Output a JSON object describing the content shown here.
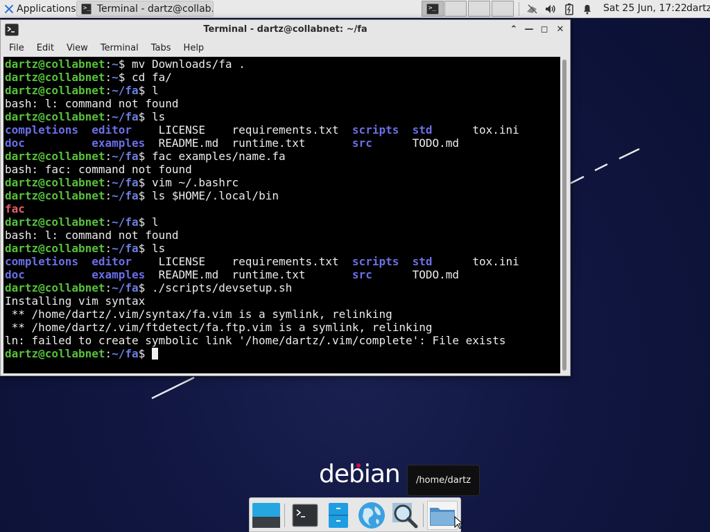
{
  "panel": {
    "apps_label": "Applications",
    "task_label": "Terminal - dartz@collab...",
    "clock": "Sat 25 Jun, 17:22",
    "user": "dartz"
  },
  "window": {
    "title": "Terminal - dartz@collabnet: ~/fa",
    "menu": [
      "File",
      "Edit",
      "View",
      "Terminal",
      "Tabs",
      "Help"
    ]
  },
  "terminal": {
    "user": "dartz@collabnet",
    "lines": [
      {
        "kind": "prompt",
        "path": "~",
        "cmd": "mv Downloads/fa ."
      },
      {
        "kind": "prompt",
        "path": "~",
        "cmd": "cd fa/"
      },
      {
        "kind": "prompt",
        "path": "~/fa",
        "cmd": "l"
      },
      {
        "kind": "out",
        "text": "bash: l: command not found"
      },
      {
        "kind": "prompt",
        "path": "~/fa",
        "cmd": "ls"
      },
      {
        "kind": "ls1"
      },
      {
        "kind": "ls2"
      },
      {
        "kind": "prompt",
        "path": "~/fa",
        "cmd": "fac examples/name.fa"
      },
      {
        "kind": "out",
        "text": "bash: fac: command not found"
      },
      {
        "kind": "prompt",
        "path": "~/fa",
        "cmd": "vim ~/.bashrc"
      },
      {
        "kind": "prompt",
        "path": "~/fa",
        "cmd": "ls $HOME/.local/bin"
      },
      {
        "kind": "exe",
        "text": "fac"
      },
      {
        "kind": "prompt",
        "path": "~/fa",
        "cmd": "l"
      },
      {
        "kind": "out",
        "text": "bash: l: command not found"
      },
      {
        "kind": "prompt",
        "path": "~/fa",
        "cmd": "ls"
      },
      {
        "kind": "ls1"
      },
      {
        "kind": "ls2"
      },
      {
        "kind": "prompt",
        "path": "~/fa",
        "cmd": "./scripts/devsetup.sh"
      },
      {
        "kind": "out",
        "text": "Installing vim syntax"
      },
      {
        "kind": "out",
        "text": " ** /home/dartz/.vim/syntax/fa.vim is a symlink, relinking"
      },
      {
        "kind": "out",
        "text": " ** /home/dartz/.vim/ftdetect/fa.ftp.vim is a symlink, relinking"
      },
      {
        "kind": "out",
        "text": "ln: failed to create symbolic link '/home/dartz/.vim/complete': File exists"
      },
      {
        "kind": "prompt",
        "path": "~/fa",
        "cmd": "",
        "cursor": true
      }
    ],
    "ls_row1": [
      {
        "text": "completions",
        "type": "dir",
        "w": 13
      },
      {
        "text": "editor",
        "type": "dir",
        "w": 10
      },
      {
        "text": "LICENSE",
        "type": "file",
        "w": 11
      },
      {
        "text": "requirements.txt",
        "type": "file",
        "w": 18
      },
      {
        "text": "scripts",
        "type": "dir",
        "w": 9
      },
      {
        "text": "std",
        "type": "dir",
        "w": 9
      },
      {
        "text": "tox.ini",
        "type": "file",
        "w": 7
      }
    ],
    "ls_row2": [
      {
        "text": "doc",
        "type": "dir",
        "w": 13
      },
      {
        "text": "examples",
        "type": "dir",
        "w": 10
      },
      {
        "text": "README.md",
        "type": "file",
        "w": 11
      },
      {
        "text": "runtime.txt",
        "type": "file",
        "w": 18
      },
      {
        "text": "src",
        "type": "dir",
        "w": 9
      },
      {
        "text": "TODO.md",
        "type": "file",
        "w": 9
      }
    ]
  },
  "desktop": {
    "logo": "debian",
    "tooltip": "/home/dartz"
  },
  "dock": {
    "items": [
      "show-desktop-icon",
      "terminal-icon",
      "file-manager-icon",
      "web-browser-icon",
      "app-finder-icon",
      "home-folder-icon"
    ]
  }
}
